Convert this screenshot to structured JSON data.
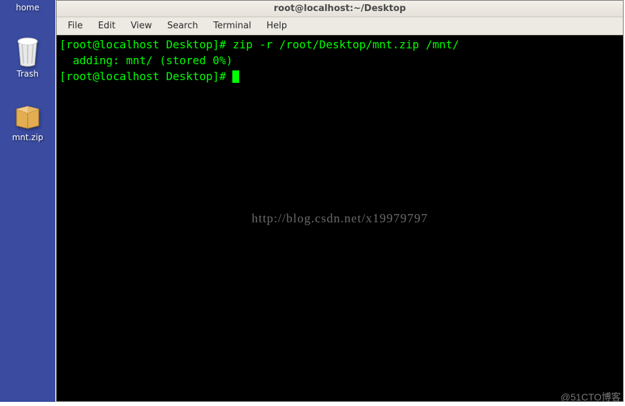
{
  "desktop": {
    "icons": [
      {
        "name": "home",
        "label": "home"
      },
      {
        "name": "trash",
        "label": "Trash"
      },
      {
        "name": "zip",
        "label": "mnt.zip"
      }
    ]
  },
  "window": {
    "title": "root@localhost:~/Desktop",
    "menu": [
      "File",
      "Edit",
      "View",
      "Search",
      "Terminal",
      "Help"
    ]
  },
  "terminal": {
    "prompt": "[root@localhost Desktop]# ",
    "command": "zip -r /root/Desktop/mnt.zip /mnt/",
    "output1": "  adding: mnt/ (stored 0%)",
    "prompt2": "[root@localhost Desktop]# "
  },
  "watermarks": {
    "center": "http://blog.csdn.net/x19979797",
    "corner": "@51CTO博客"
  }
}
